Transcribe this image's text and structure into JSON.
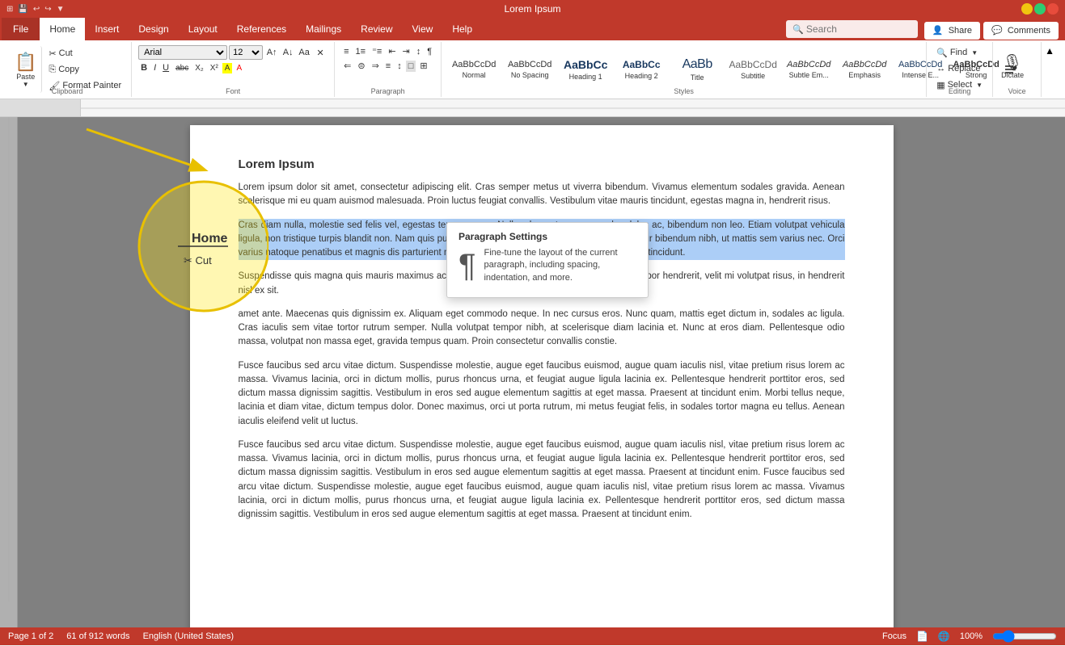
{
  "titleBar": {
    "title": "Lorem Ipsum",
    "icons": [
      "grid",
      "save",
      "arrow-back",
      "arrow-forward"
    ]
  },
  "menuBar": {
    "items": [
      "File",
      "Home",
      "Insert",
      "Design",
      "Layout",
      "References",
      "Mailings",
      "Review",
      "View",
      "Help"
    ],
    "activeItem": "Home",
    "search": {
      "placeholder": "Search",
      "value": ""
    }
  },
  "headerButtons": {
    "share": "Share",
    "comments": "Comments"
  },
  "ribbon": {
    "clipboard": {
      "label": "Clipboard",
      "paste": "Paste",
      "cut": "Cut",
      "copy": "Copy",
      "formatPainter": "Format Painter"
    },
    "font": {
      "label": "Font",
      "fontName": "Arial",
      "fontSize": "12",
      "bold": "B",
      "italic": "I",
      "underline": "U",
      "strikethrough": "abc",
      "subscript": "X₂",
      "superscript": "X²"
    },
    "paragraph": {
      "label": "Paragraph"
    },
    "styles": {
      "label": "Styles",
      "items": [
        {
          "name": "Normal",
          "class": "sn"
        },
        {
          "name": "No Spacing",
          "class": "sno-sp"
        },
        {
          "name": "Heading 1",
          "class": "sh1"
        },
        {
          "name": "Heading 2",
          "class": "sh2"
        },
        {
          "name": "Title",
          "class": "stitle"
        },
        {
          "name": "Subtitle",
          "class": "ssubt"
        },
        {
          "name": "Subtle Em...",
          "class": "semph"
        },
        {
          "name": "Emphasis",
          "class": "semph"
        },
        {
          "name": "Intense E...",
          "class": "sinte"
        },
        {
          "name": "Strong",
          "class": "sstrong"
        }
      ]
    },
    "editing": {
      "label": "Editing",
      "find": "Find",
      "replace": "Replace",
      "select": "Select"
    },
    "voice": {
      "label": "Voice",
      "dictate": "Dictate"
    }
  },
  "document": {
    "title": "Lorem Ipsum",
    "paragraphs": [
      "Lorem ipsum dolor sit amet, consectetur adipiscing elit. Cras semper metus ut viverra bibendum. Vivamus elementum sodales gravida. Aenean scelerisque mi eu quam auismod malesuada. Proin luctus feugiat convallis. Vestibulum vitae mauris tincidunt, egestas magna in, hendrerit risus.",
      "Cras diam nulla, molestie sed felis vel, egestas tempus nunc. Nullam leo ante, ornare sed sodales ac, bibendum non leo. Etiam volutpat vehicula ligula, non tristique turpis blandit non. Nam quis pulvinar velit, nec pulvinar ligula. Vestibulum efficitur bibendum nibh, ut mattis sem varius nec. Orci varius natoque penatibus et magnis dis parturient montes, nascetur ridiculus mus. In tempus varius tincidunt.",
      "Suspendisse quis magna quis mauris maximus accumsan ac vel dui. Fusce viverra, felis vitae tempor hendrerit, velit mi volutpat risus, in hendrerit nisl ex sit.",
      "amet ante. Maecenas quis dignissim ex. Aliquam eget commodo neque. In nec cursus eros. Nunc quam, mattis eget dictum in, sodales ac ligula. Cras iaculis sem vitae tortor rutrum semper. Nulla volutpat tempor nibh, at scelerisque diam lacinia et. Nunc at eros diam. Pellentesque odio massa, volutpat non massa eget, gravida tempus quam. Proin consectetur convallis constie.",
      "Fusce faucibus sed arcu vitae dictum. Suspendisse molestie, augue eget faucibus euismod, augue quam iaculis nisl, vitae pretium risus lorem ac massa. Vivamus lacinia, orci in dictum mollis, purus rhoncus urna, et feugiat augue ligula lacinia ex. Pellentesque hendrerit porttitor eros, sed dictum massa dignissim sagittis. Vestibulum in eros sed augue elementum sagittis at eget massa. Praesent at tincidunt enim. Morbi tellus neque, lacinia et diam vitae, dictum tempus dolor. Donec maximus, orci ut porta rutrum, mi metus feugiat felis, in sodales tortor magna eu tellus. Aenean iaculis eleifend velit ut luctus.",
      "Fusce faucibus sed arcu vitae dictum. Suspendisse molestie, augue eget faucibus euismod, augue quam iaculis nisl, vitae pretium risus lorem ac massa. Vivamus lacinia, orci in dictum mollis, purus rhoncus urna, et feugiat augue ligula lacinia ex. Pellentesque hendrerit porttitor eros, sed dictum massa dignissim sagittis. Vestibulum in eros sed augue elementum sagittis at eget massa. Praesent at tincidunt enim. Fusce faucibus sed arcu vitae dictum. Suspendisse molestie, augue eget faucibus euismod, augue quam iaculis nisl, vitae pretium risus lorem ac massa. Vivamus lacinia, orci in dictum mollis, purus rhoncus urna, et feugiat augue ligula lacinia ex. Pellentesque hendrerit porttitor eros, sed dictum massa dignissim sagittis. Vestibulum in eros sed augue elementum sagittis at eget massa. Praesent at tincidunt enim."
    ]
  },
  "tooltip": {
    "title": "Paragraph Settings",
    "text": "Fine-tune the layout of the current paragraph, including spacing, indentation, and more."
  },
  "annotation": {
    "items": [
      "Home",
      "Cut"
    ]
  },
  "statusBar": {
    "page": "Page 1 of 2",
    "words": "61 of 912 words",
    "language": "English (United States)",
    "focus": "Focus",
    "zoom": "100%"
  }
}
